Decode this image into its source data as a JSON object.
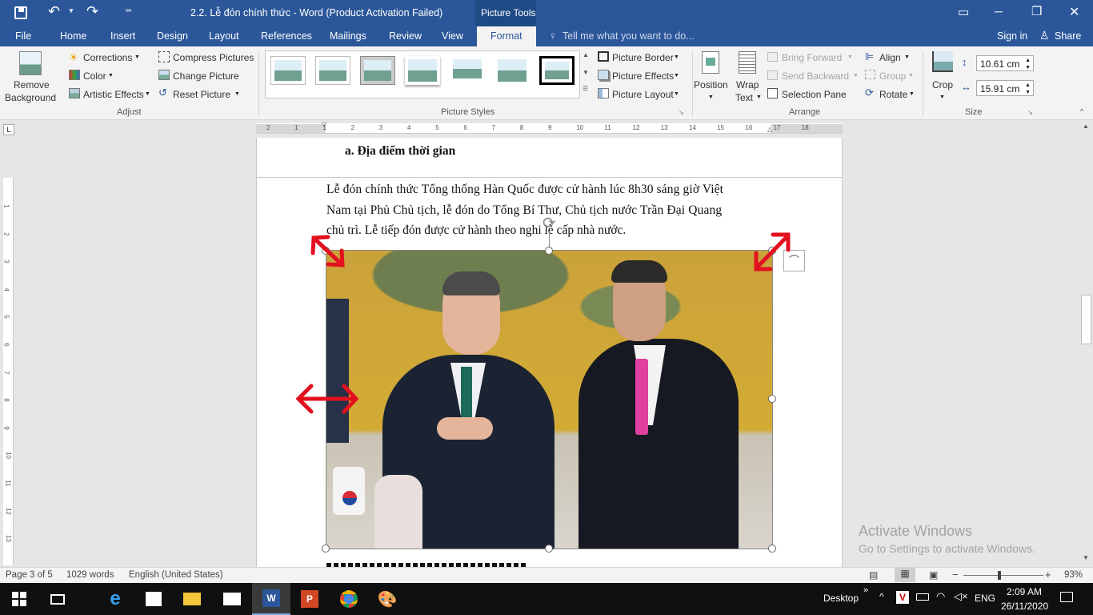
{
  "window": {
    "title": "2.2. Lễ đón chính thức - Word (Product Activation Failed)",
    "context_tab": "Picture Tools",
    "controls": [
      "▭",
      "─",
      "❐",
      "✕"
    ]
  },
  "tabs": [
    {
      "label": "File"
    },
    {
      "label": "Home"
    },
    {
      "label": "Insert"
    },
    {
      "label": "Design"
    },
    {
      "label": "Layout"
    },
    {
      "label": "References"
    },
    {
      "label": "Mailings"
    },
    {
      "label": "Review"
    },
    {
      "label": "View"
    },
    {
      "label": "Format"
    }
  ],
  "tell_me": "Tell me what you want to do...",
  "sign_in": "Sign in",
  "share": "Share",
  "ribbon": {
    "adjust": {
      "remove_bg_1": "Remove",
      "remove_bg_2": "Background",
      "corrections": "Corrections",
      "color": "Color",
      "artistic": "Artistic Effects",
      "compress": "Compress Pictures",
      "change": "Change Picture",
      "reset": "Reset Picture",
      "group": "Adjust"
    },
    "styles": {
      "border": "Picture Border",
      "effects": "Picture Effects",
      "layout": "Picture Layout",
      "group": "Picture Styles"
    },
    "arrange": {
      "position": "Position",
      "wrap_1": "Wrap",
      "wrap_2": "Text",
      "bring": "Bring Forward",
      "send": "Send Backward",
      "pane": "Selection Pane",
      "align": "Align",
      "group_btn": "Group",
      "rotate": "Rotate",
      "group": "Arrange"
    },
    "size": {
      "crop": "Crop",
      "height": "10.61 cm",
      "width": "15.91 cm",
      "group": "Size"
    }
  },
  "ruler_numbers": [
    "2",
    "1",
    "1",
    "2",
    "3",
    "4",
    "5",
    "6",
    "7",
    "8",
    "9",
    "10",
    "11",
    "12",
    "13",
    "14",
    "15",
    "16",
    "17",
    "18"
  ],
  "vruler_numbers": [
    "1",
    "2",
    "3",
    "4",
    "5",
    "6",
    "7",
    "8",
    "9",
    "10",
    "11",
    "12",
    "13"
  ],
  "document": {
    "heading": "a.  Địa điểm thời gian",
    "para_line1": "Lễ đón chính thức Tổng thống Hàn Quốc được cử hành lúc 8h30 sáng giờ Việt",
    "para_line2": "Nam tại Phủ Chủ tịch, lễ đón do Tổng Bí Thư, Chủ tịch nước Trần Đại Quang",
    "para_line3": "chủ trì. Lễ tiếp đón được cử hành theo nghi lễ cấp nhà nước."
  },
  "watermark": {
    "line1": "Activate Windows",
    "line2": "Go to Settings to activate Windows."
  },
  "status": {
    "page": "Page 3 of 5",
    "words": "1029 words",
    "language": "English (United States)",
    "zoom": "93%"
  },
  "taskbar": {
    "desktop": "Desktop",
    "lang": "ENG",
    "time": "2:09 AM",
    "date": "26/11/2020"
  },
  "colors": {
    "word_blue": "#2b579a",
    "annotation_red": "#e3101f"
  }
}
